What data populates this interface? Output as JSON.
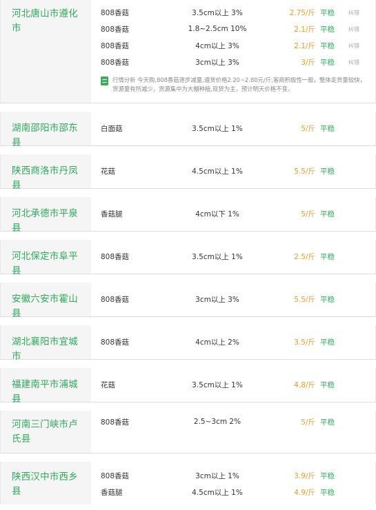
{
  "markets": [
    {
      "region": "河北唐山市遵化市",
      "rows": [
        {
          "variety": "808香菇",
          "spec": "3.5cm以上 3%",
          "price": "2.75/斤",
          "trend": "平稳",
          "report": "纠错"
        },
        {
          "variety": "808香菇",
          "spec": "1.8~2.5cm 10%",
          "price": "2.1/斤",
          "trend": "平稳",
          "report": "纠错"
        },
        {
          "variety": "808香菇",
          "spec": "4cm以上 3%",
          "price": "2.1/斤",
          "trend": "平稳",
          "report": "纠错"
        },
        {
          "variety": "808香菇",
          "spec": "3cm以上 3%",
          "price": "3/斤",
          "trend": "平稳",
          "report": "纠错"
        }
      ],
      "analysis": "行情分析 今天购,808香菇逐步减量,遵货价格2.20~2.80元/斤,客商积极性一般，整体走货量较快，货源量有所减少，货源集中为大棚种植,现货为主，预计明天价格不变。"
    },
    {
      "region": "湖南邵阳市邵东县",
      "rows": [
        {
          "variety": "白面菇",
          "spec": "3.5cm以上 1%",
          "price": "5/斤",
          "trend": "平稳"
        }
      ]
    },
    {
      "region": "陕西商洛市丹凤县",
      "rows": [
        {
          "variety": "花菇",
          "spec": "4.5cm以上 1%",
          "price": "5.5/斤",
          "trend": "平稳"
        }
      ]
    },
    {
      "region": "河北承德市平泉县",
      "rows": [
        {
          "variety": "香菇腿",
          "spec": "4cm以下 1%",
          "price": "5/斤",
          "trend": "平稳"
        }
      ]
    },
    {
      "region": "河北保定市阜平县",
      "rows": [
        {
          "variety": "808香菇",
          "spec": "3.5cm以上 1%",
          "price": "2.5/斤",
          "trend": "平稳"
        }
      ]
    },
    {
      "region": "安徽六安市霍山县",
      "rows": [
        {
          "variety": "808香菇",
          "spec": "3cm以上 3%",
          "price": "5.5/斤",
          "trend": "平稳"
        }
      ]
    },
    {
      "region": "湖北襄阳市宜城市",
      "rows": [
        {
          "variety": "808香菇",
          "spec": "4cm以上 2%",
          "price": "3.5/斤",
          "trend": "平稳"
        }
      ]
    },
    {
      "region": "福建南平市浦城县",
      "rows": [
        {
          "variety": "花菇",
          "spec": "3.5cm以上 1%",
          "price": "4.8/斤",
          "trend": "平稳"
        }
      ]
    },
    {
      "region": "河南三门峡市卢氏县",
      "rows": [
        {
          "variety": "808香菇",
          "spec": "2.5~3cm 2%",
          "price": "5/斤",
          "trend": "平稳"
        }
      ]
    },
    {
      "region": "陕西汉中市西乡县",
      "rows": [
        {
          "variety": "808香菇",
          "spec": "3cm以上 1%",
          "price": "3.9/斤",
          "trend": "平稳"
        },
        {
          "variety": "香菇腿",
          "spec": "4.5cm以上 1%",
          "price": "4.9/斤",
          "trend": "平稳"
        }
      ]
    }
  ]
}
